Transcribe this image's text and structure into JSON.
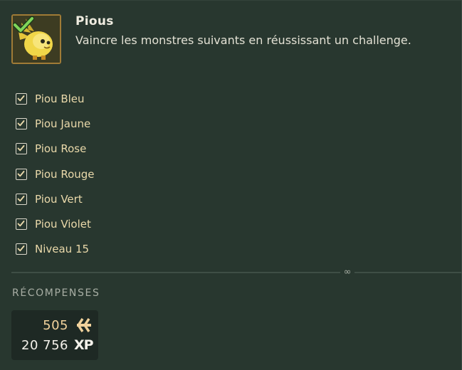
{
  "quest": {
    "title": "Pious",
    "description": "Vaincre les monstres suivants en réussissant un challenge.",
    "icon": "yellow-piou-quest-icon",
    "completed": true
  },
  "objectives": [
    {
      "label": "Piou Bleu",
      "checked": true
    },
    {
      "label": "Piou Jaune",
      "checked": true
    },
    {
      "label": "Piou Rose",
      "checked": true
    },
    {
      "label": "Piou Rouge",
      "checked": true
    },
    {
      "label": "Piou Vert",
      "checked": true
    },
    {
      "label": "Piou Violet",
      "checked": true
    },
    {
      "label": "Niveau 15",
      "checked": true
    }
  ],
  "divider_symbol": "∞",
  "rewards": {
    "title": "RÉCOMPENSES",
    "kamas": "505",
    "xp": "20 756",
    "xp_label": "XP"
  },
  "colors": {
    "background": "#28372f",
    "objective_text": "#ead9aa",
    "kamas_text": "#f1d29c",
    "check_green": "#7fd65a"
  }
}
